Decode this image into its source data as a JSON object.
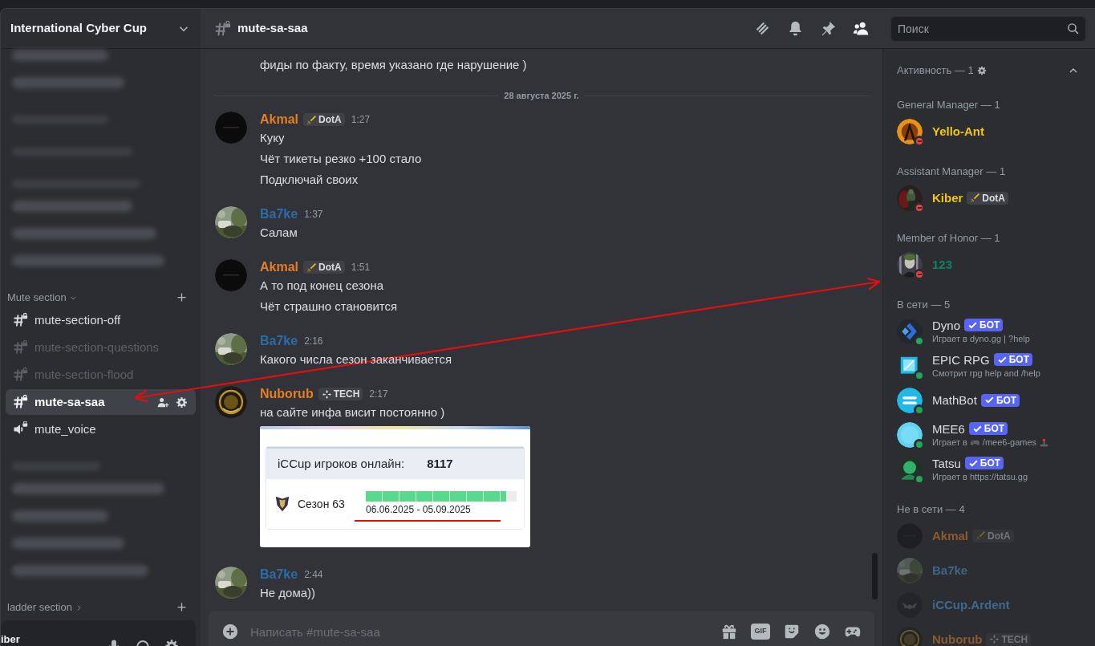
{
  "sidebar": {
    "server_name": "International Cyber Cup",
    "channels": [
      {
        "kind": "blurred_channel"
      },
      {
        "kind": "blurred_channel"
      },
      {
        "kind": "blurred_category"
      },
      {
        "kind": "blurred_category"
      },
      {
        "kind": "blurred_category"
      },
      {
        "kind": "blurred_channel"
      },
      {
        "kind": "blurred_channel"
      },
      {
        "kind": "blurred_channel"
      },
      {
        "kind": "category",
        "label": "Mute section",
        "expanded": true
      },
      {
        "kind": "text",
        "label": "mute-section-off",
        "unread": true,
        "selected": false
      },
      {
        "kind": "text",
        "label": "mute-section-questions",
        "unread": false,
        "selected": false
      },
      {
        "kind": "text",
        "label": "mute-section-flood",
        "unread": false,
        "selected": false
      },
      {
        "kind": "text",
        "label": "mute-sa-saa",
        "unread": true,
        "selected": true
      },
      {
        "kind": "voice",
        "label": "mute_voice",
        "unread": true,
        "selected": false
      },
      {
        "kind": "blurred_category"
      },
      {
        "kind": "blurred_channel"
      },
      {
        "kind": "blurred_channel"
      },
      {
        "kind": "blurred_channel"
      },
      {
        "kind": "blurred_channel"
      },
      {
        "kind": "category",
        "label": "ladder section",
        "expanded": false
      }
    ],
    "user_panel": {
      "name": "iber"
    }
  },
  "chat": {
    "channel": "mute-sa-saa",
    "items": [
      {
        "kind": "continuation",
        "lines": [
          "фиды по факту, время указано где нарушение )"
        ]
      },
      {
        "kind": "divider",
        "label": "28 августа 2025 г."
      },
      {
        "kind": "message",
        "author": "Akmal",
        "color": "#e67e22",
        "badge": {
          "kind": "sword",
          "label": "DotA"
        },
        "time": "1:27",
        "lines": [
          "Куку",
          "Чёт тикеты резко +100 стало",
          "Подключай своих"
        ]
      },
      {
        "kind": "message",
        "author": "Ba7ke",
        "color": "#2d6ca8",
        "time": "1:37",
        "lines": [
          "Салам"
        ]
      },
      {
        "kind": "message",
        "author": "Akmal",
        "color": "#e67e22",
        "badge": {
          "kind": "sword",
          "label": "DotA"
        },
        "time": "1:51",
        "lines": [
          "А то под конец сезона",
          "Чёт страшно становится"
        ]
      },
      {
        "kind": "message",
        "author": "Ba7ke",
        "color": "#2d6ca8",
        "time": "2:16",
        "lines": [
          "Какого числа сезон заканчивается"
        ]
      },
      {
        "kind": "message",
        "author": "Nuborub",
        "color": "#e67e22",
        "badge": {
          "kind": "tech",
          "label": "TECH"
        },
        "time": "2:17",
        "lines": [
          "на сайте инфа висит постоянно )"
        ],
        "attachment": {
          "kind": "screenshot",
          "online_label": "iCCup игроков онлайн:",
          "online_count": "8117",
          "season": "Сезон 63",
          "level": 0.93,
          "dates": "06.06.2025 - 05.09.2025"
        }
      },
      {
        "kind": "message",
        "author": "Ba7ke",
        "color": "#2d6ca8",
        "time": "2:44",
        "lines": [
          "Не дома))"
        ]
      }
    ],
    "composer": {
      "placeholder": "Написать #mute-sa-saa",
      "buttons": [
        {
          "kind": "gift"
        },
        {
          "kind": "gif",
          "label": "GIF"
        },
        {
          "kind": "sticker"
        },
        {
          "kind": "emoji"
        },
        {
          "kind": "apps"
        }
      ]
    }
  },
  "members": {
    "search": {
      "placeholder": "Поиск"
    },
    "header": "Активность — 1",
    "sections": [
      {
        "title": "General Manager — 1",
        "members": [
          {
            "name": "Yello-Ant",
            "color": "#f1c40f",
            "kind": "dnd"
          }
        ]
      },
      {
        "title": "Assistant Manager — 1",
        "members": [
          {
            "name": "Kiber",
            "color": "#f1c40f",
            "kind": "dnd",
            "badge": {
              "kind": "sword",
              "label": "DotA"
            }
          }
        ]
      },
      {
        "title": "Member of Honor — 1",
        "members": [
          {
            "name": "123",
            "color": "#11806a",
            "kind": "dnd"
          }
        ]
      },
      {
        "title": "В сети — 5",
        "members": [
          {
            "name": "Dyno",
            "color": "#dbdee1",
            "kind": "online",
            "badge": {
              "kind": "bot",
              "label": "БОТ"
            },
            "activity": "Играет в dyno.gg | ?help"
          },
          {
            "name": "EPIC RPG",
            "color": "#dbdee1",
            "kind": "online",
            "badge": {
              "kind": "bot",
              "label": "БОТ"
            },
            "activity": "Смотрит rpg help and /help"
          },
          {
            "name": "MathBot",
            "color": "#dbdee1",
            "kind": "online",
            "badge": {
              "kind": "bot",
              "label": "БОТ"
            }
          },
          {
            "name": "MEE6",
            "color": "#dbdee1",
            "kind": "online",
            "badge": {
              "kind": "bot",
              "label": "БОТ"
            },
            "activity": [
              {
                "kind": "text",
                "text": "Играет в"
              },
              {
                "kind": "gamepad"
              },
              {
                "kind": "text",
                "text": "/mee6-games"
              },
              {
                "kind": "joystick"
              }
            ]
          },
          {
            "name": "Tatsu",
            "color": "#dbdee1",
            "kind": "online",
            "badge": {
              "kind": "bot",
              "label": "БОТ"
            },
            "activity": "Играет в https://tatsu.gg"
          }
        ]
      },
      {
        "title": "Не в сети — 4",
        "members": [
          {
            "name": "Akmal",
            "color": "#8e5a2e",
            "kind": "offline",
            "badge": {
              "kind": "sword",
              "label": "DotA"
            }
          },
          {
            "name": "Ba7ke",
            "color": "#3e6688",
            "kind": "offline"
          },
          {
            "name": "iCCup.Ardent",
            "color": "#3e6a92",
            "kind": "offline"
          },
          {
            "name": "Nuborub",
            "color": "#8e5a2e",
            "kind": "offline",
            "badge": {
              "kind": "tech",
              "label": "TECH"
            }
          }
        ]
      }
    ]
  }
}
